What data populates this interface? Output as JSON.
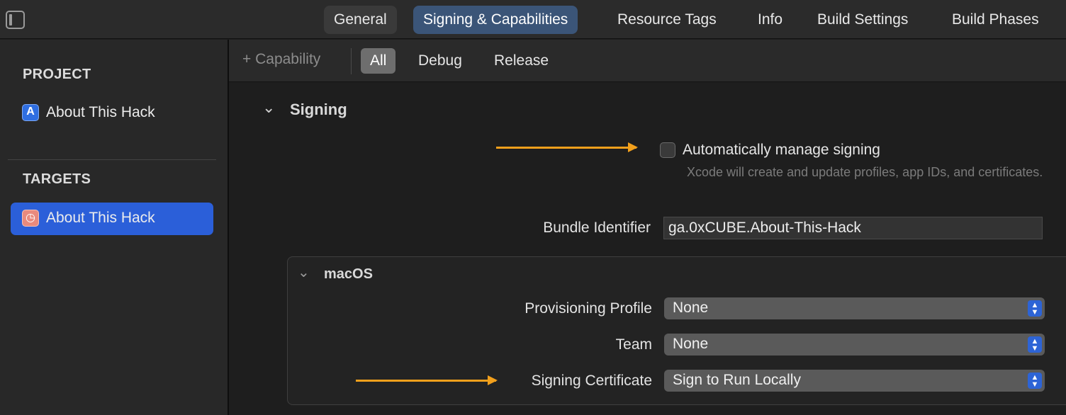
{
  "top_tabs": [
    "General",
    "Signing & Capabilities",
    "Resource Tags",
    "Info",
    "Build Settings",
    "Build Phases"
  ],
  "sidebar": {
    "project_heading": "PROJECT",
    "project_item": "About This Hack",
    "targets_heading": "TARGETS",
    "target_item": "About This Hack"
  },
  "toolbar": {
    "capability_label": "+ Capability",
    "filters": [
      "All",
      "Debug",
      "Release"
    ]
  },
  "signing": {
    "title": "Signing",
    "auto_manage_label": "Automatically manage signing",
    "auto_manage_checked": false,
    "auto_manage_hint": "Xcode will create and update profiles, app IDs, and certificates.",
    "bundle_id_label": "Bundle Identifier",
    "bundle_id_value": "ga.0xCUBE.About-This-Hack"
  },
  "macos": {
    "title": "macOS",
    "provisioning_profile_label": "Provisioning Profile",
    "provisioning_profile_value": "None",
    "team_label": "Team",
    "team_value": "None",
    "signing_certificate_label": "Signing Certificate",
    "signing_certificate_value": "Sign to Run Locally"
  },
  "colors": {
    "accent_blue": "#2b5fd9",
    "selected_tab": "#3b5578",
    "annotation_arrow": "#f2a01c"
  }
}
